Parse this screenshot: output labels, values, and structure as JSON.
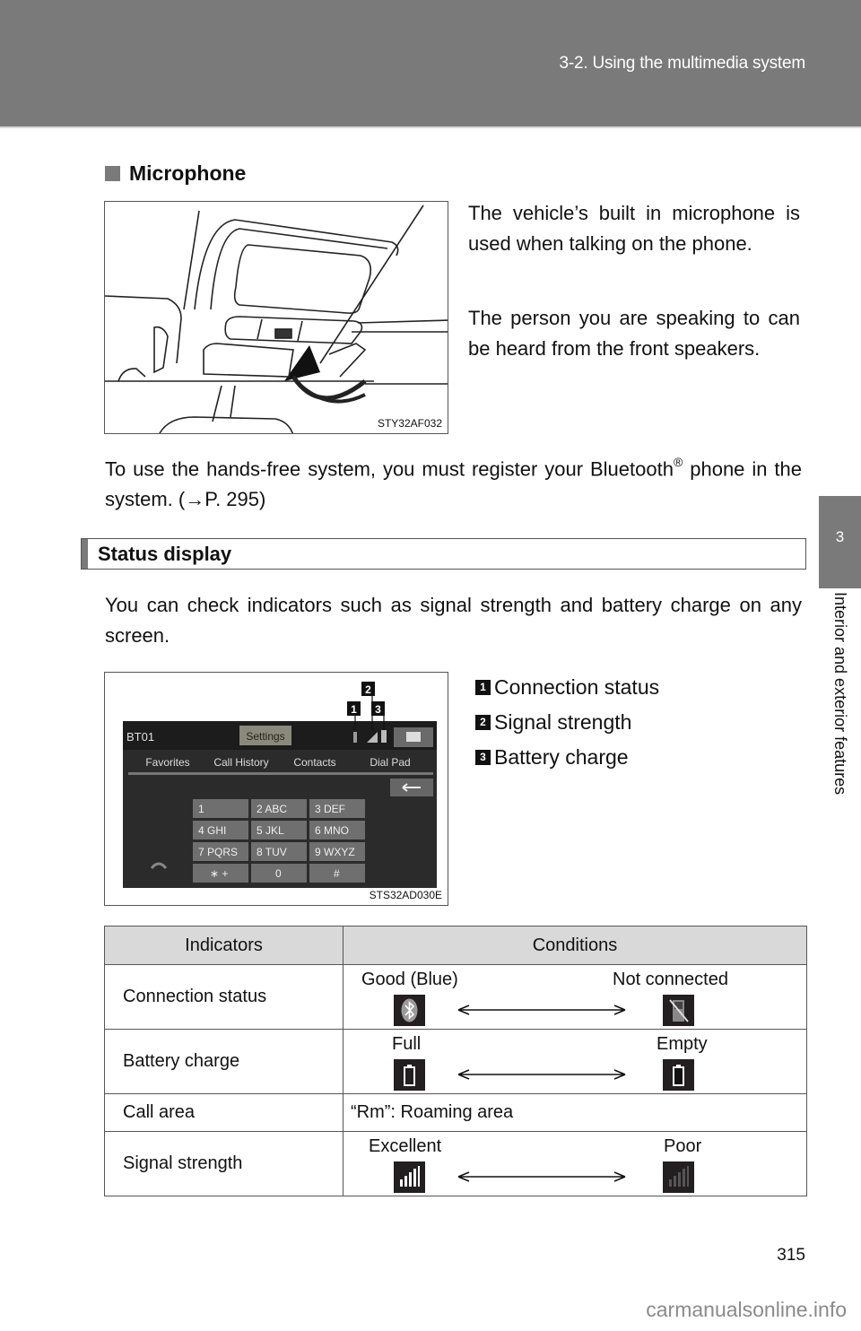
{
  "header": {
    "title": "3-2. Using the multimedia system"
  },
  "side_tab": {
    "chapter_number": "3",
    "chapter_title": "Interior and exterior features"
  },
  "microphone": {
    "heading": "Microphone",
    "figure_code": "STY32AF032",
    "paragraphs": [
      "The vehicle’s built in microphone is used when talking on the phone.",
      "The person you are speaking to can be heard from the front speakers."
    ],
    "register_text": "To use the hands-free system, you must register your Bluetooth",
    "register_sup": "®",
    "register_text2": " phone in the system. (→P. 295)"
  },
  "status_display": {
    "heading": "Status display",
    "intro": "You can check indicators such as signal strength and battery charge on any screen.",
    "figure_code": "STS32AD030E",
    "screen": {
      "device_name": "BT01",
      "settings_label": "Settings",
      "tabs": [
        "Favorites",
        "Call History",
        "Contacts",
        "Dial Pad"
      ],
      "keys": [
        "1",
        "2 ABC",
        "3 DEF",
        "4 GHI",
        "5 JKL",
        "6 MNO",
        "7 PQRS",
        "8 TUV",
        "9 WXYZ",
        "∗ +",
        "0",
        "#"
      ],
      "callouts": [
        "1",
        "2",
        "3"
      ]
    },
    "legend": [
      {
        "num": "1",
        "label": "Connection status"
      },
      {
        "num": "2",
        "label": "Signal strength"
      },
      {
        "num": "3",
        "label": "Battery charge"
      }
    ]
  },
  "indicators_table": {
    "headers": [
      "Indicators",
      "Conditions"
    ],
    "rows": [
      {
        "indicator": "Connection status",
        "left": "Good (Blue)",
        "right": "Not connected",
        "left_icon": "bluetooth-icon",
        "right_icon": "phone-not-connected-icon"
      },
      {
        "indicator": "Battery charge",
        "left": "Full",
        "right": "Empty",
        "left_icon": "battery-full-icon",
        "right_icon": "battery-empty-icon"
      },
      {
        "indicator": "Call area",
        "text": "“Rm”: Roaming area"
      },
      {
        "indicator": "Signal strength",
        "left": "Excellent",
        "right": "Poor",
        "left_icon": "signal-excellent-icon",
        "right_icon": "signal-poor-icon"
      }
    ]
  },
  "footer": {
    "page_number": "315",
    "watermark": "carmanualsonline.info"
  }
}
